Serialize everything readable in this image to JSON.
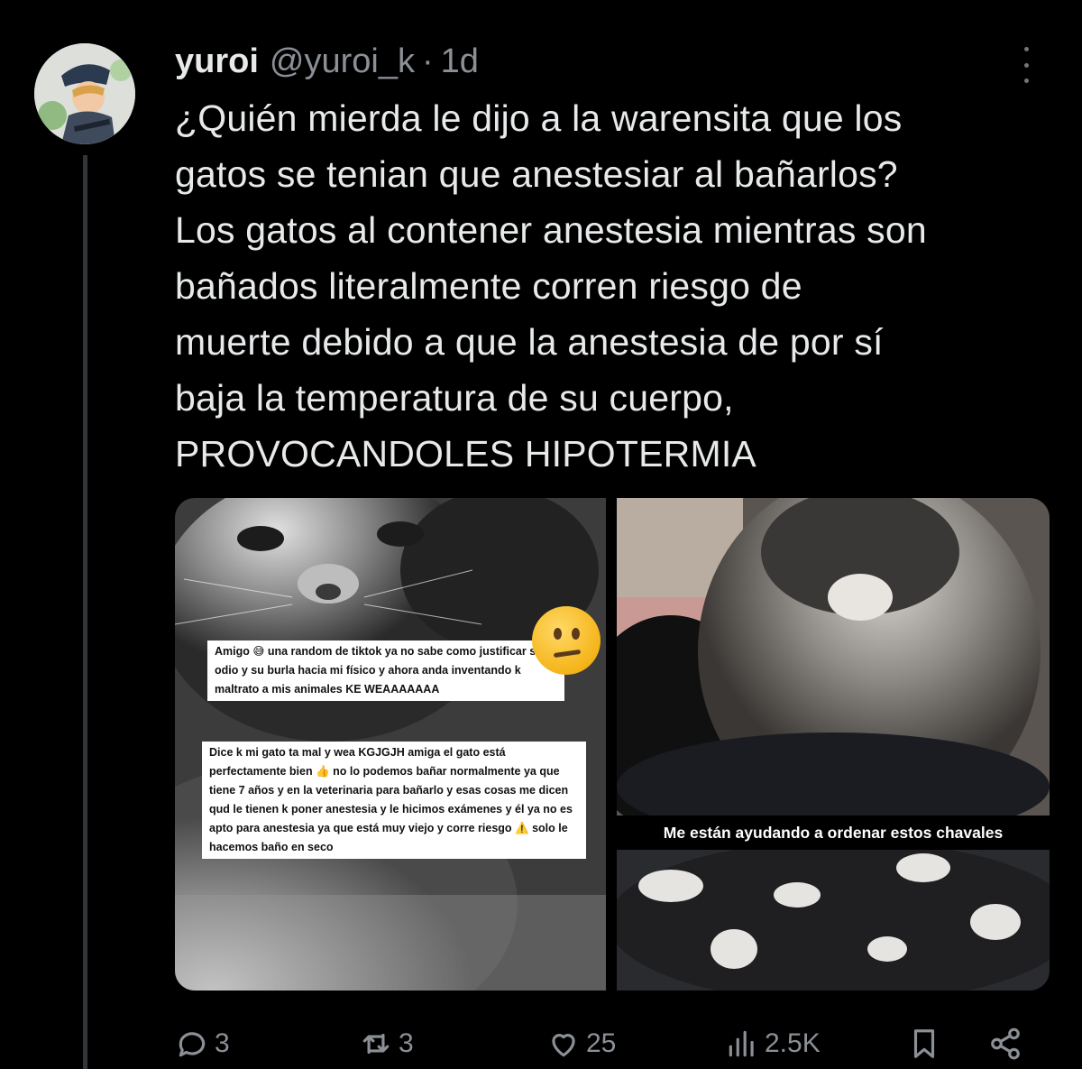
{
  "tweet": {
    "author": {
      "display_name": "yuroi",
      "handle": "@yuroi_k",
      "separator": "·",
      "time": "1d"
    },
    "text": "¿Quién mierda le dijo a la warensita que los\ngatos se tenian que anestesiar al bañarlos?\nLos gatos al contener anestesia mientras son\nbañados literalmente corren riesgo de\nmuerte debido a que la anestesia de por sí\nbaja la temperatura de su cuerpo,\nPROVOCANDOLES HIPOTERMIA",
    "media": {
      "left": {
        "caption_1": "Amigo 😅 una random de tiktok ya no sabe como justificar su odio y su burla hacia mi físico y ahora anda inventando k maltrato a mis animales KE WEAAAAAAA",
        "caption_2": "Dice k mi gato ta mal y wea KGJGJH amiga el gato está perfectamente bien 👍 no lo podemos bañar normalmente ya que tiene 7 años y en la veterinaria para bañarlo y esas cosas me dicen qud le tienen k poner anestesia y le hicimos exámenes y él ya no es apto para anestesia ya que está muy viejo y corre riesgo ⚠️ solo le hacemos baño en seco"
      },
      "right": {
        "caption": "Me están ayudando a ordenar estos chavales"
      }
    },
    "actions": {
      "replies": "3",
      "reposts": "3",
      "likes": "25",
      "views": "2.5K"
    }
  },
  "icons": {
    "more": "more-icon",
    "reply": "reply-icon",
    "repost": "repost-icon",
    "like": "heart-icon",
    "views": "views-icon",
    "bookmark": "bookmark-icon",
    "share": "share-icon"
  },
  "colors": {
    "background": "#000000",
    "text": "#e7e9ea",
    "muted": "#8b9096"
  }
}
